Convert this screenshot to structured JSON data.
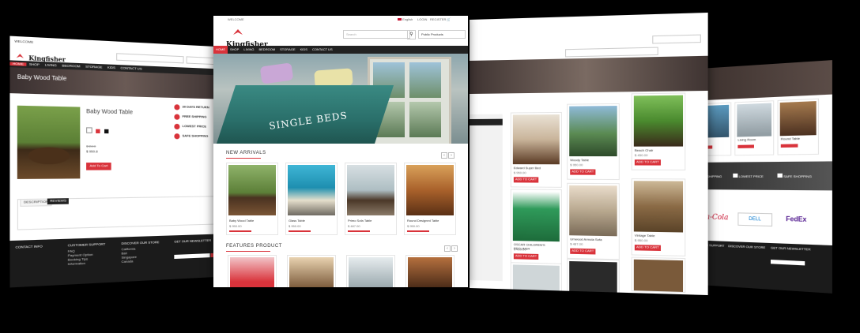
{
  "brand": {
    "name": "Kingfisher"
  },
  "topbar": {
    "welcome": "WELCOME",
    "language": "English",
    "login": "LOGIN",
    "register": "REGISTER"
  },
  "search": {
    "placeholder": "Search",
    "category": "Public Products"
  },
  "nav": {
    "items": [
      "HOME",
      "SHOP",
      "LIVING",
      "BEDROOM",
      "STORAGE",
      "KIDS",
      "CONTACT US"
    ]
  },
  "hero": {
    "banner_text": "SINGLE BEDS"
  },
  "new_arrivals": {
    "title": "NEW ARRIVALS",
    "products": [
      {
        "name": "Baby Wood Table",
        "price": "$ 950.00"
      },
      {
        "name": "Glass Table",
        "price": "$ 950.00"
      },
      {
        "name": "Primo Sofa Table",
        "price": "$ 487.00"
      },
      {
        "name": "Round Designed Table",
        "price": "$ 950.00"
      }
    ]
  },
  "features": {
    "title": "FEATURES PRODUCT"
  },
  "left_page": {
    "breadcrumb_title": "Baby Wood Table",
    "product_title": "Baby Wood Table",
    "price_old": "$ 24.0",
    "price": "$ 950.8",
    "add_to_cart": "Add To Cart",
    "tabs": [
      "DESCRIPTION",
      "REVIEWS"
    ],
    "badges": [
      "30 DAYS RETURN",
      "FREE SHIPPING",
      "LOWEST PRICE",
      "SAFE SHOPPING"
    ]
  },
  "footer": {
    "contact": "CONTACT INFO",
    "support": "CUSTOMER SUPPORT",
    "discover": "DISCOVER OUR STORE",
    "newsletter": "GET OUR NEWSLETTER",
    "support_links": [
      "FAQ",
      "Payment Option",
      "Booking Tips",
      "Information"
    ],
    "store_links": [
      "California",
      "Bali",
      "Singapore",
      "Canada"
    ]
  },
  "right_page": {
    "products": [
      {
        "name": "Edward Super Bed",
        "price": "$ 950.00"
      },
      {
        "name": "Woody Table",
        "price": "$ 950.00"
      },
      {
        "name": "Beach Chair",
        "price": "$ 450.00"
      },
      {
        "name": "OSCAR CHILDREN'S RECLINER",
        "price": "$ 450.00"
      },
      {
        "name": "Umwood Armola Sofa",
        "price": "$ 487.00"
      },
      {
        "name": "Vintage Table",
        "price": "$ 950.00"
      }
    ],
    "add_to_cart": "ADD TO CART"
  },
  "far_right": {
    "features": [
      "FREE SHIPPING",
      "LOWEST PRICE",
      "SAFE SHOPPING"
    ],
    "brands": [
      "Coca-Cola",
      "DELL",
      "FedEx"
    ],
    "products": [
      "Round Table",
      "Living Room",
      "Garden Set"
    ]
  },
  "colors": {
    "accent": "#d9333b",
    "nav": "#222222",
    "footer": "#1b1b1b"
  }
}
